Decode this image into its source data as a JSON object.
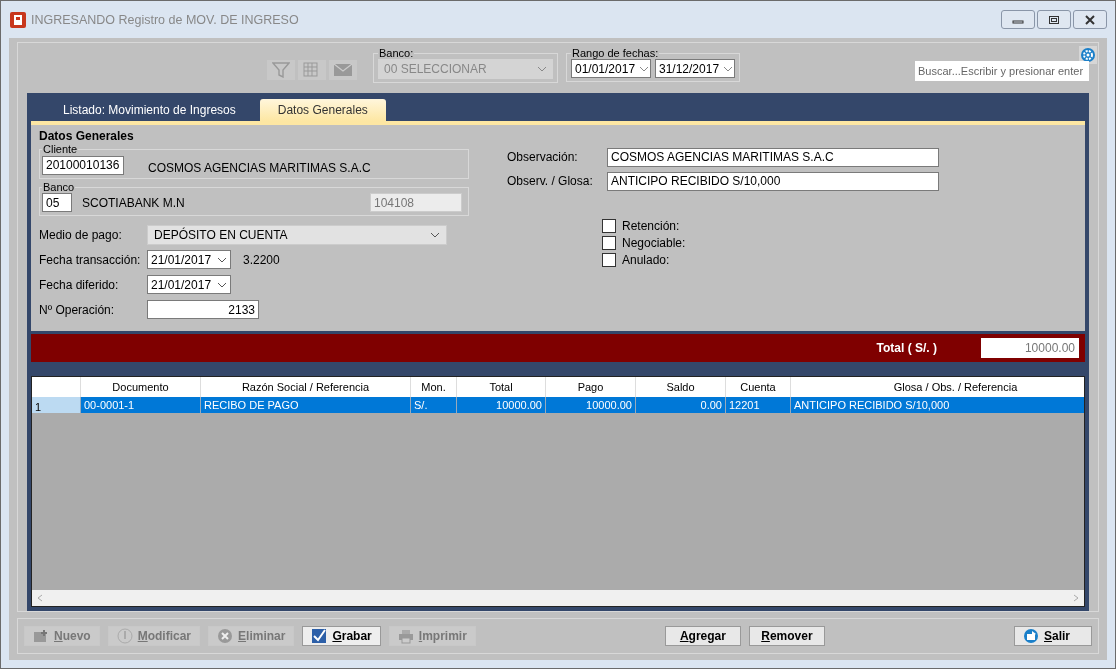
{
  "window": {
    "title": "INGRESANDO Registro de MOV. DE INGRESO"
  },
  "toolbar": {
    "banco": {
      "label": "Banco:",
      "value": "00 SELECCIONAR",
      "disabled": true
    },
    "rango": {
      "label": "Rango de fechas:",
      "from": "01/01/2017",
      "to": "31/12/2017"
    },
    "search": {
      "placeholder": "Buscar...Escribir y presionar enter"
    }
  },
  "tabs": [
    {
      "label": "Listado: Movimiento de Ingresos",
      "selected": false
    },
    {
      "label": "Datos Generales",
      "selected": true
    }
  ],
  "form": {
    "title": "Datos Generales",
    "cliente": {
      "label": "Cliente",
      "code": "20100010136",
      "name": "COSMOS AGENCIAS MARITIMAS S.A.C"
    },
    "banco": {
      "label": "Banco",
      "code": "05",
      "name": "SCOTIABANK M.N",
      "account": "104108"
    },
    "medio_pago": {
      "label": "Medio de pago:",
      "value": "DEPÓSITO EN CUENTA"
    },
    "fecha_transaccion": {
      "label": "Fecha transacción:",
      "value": "21/01/2017",
      "rate": "3.2200"
    },
    "fecha_diferido": {
      "label": "Fecha diferido:",
      "value": "21/01/2017"
    },
    "operacion": {
      "label": "Nº Operación:",
      "value": "2133"
    },
    "observacion": {
      "label": "Observación:",
      "value": "COSMOS AGENCIAS MARITIMAS S.A.C"
    },
    "glosa": {
      "label": "Observ. / Glosa:",
      "value": "ANTICIPO RECIBIDO S/10,000"
    },
    "checkboxes": [
      {
        "label": "Retención:",
        "checked": false
      },
      {
        "label": "Negociable:",
        "checked": false
      },
      {
        "label": "Anulado:",
        "checked": false
      }
    ]
  },
  "total": {
    "label": "Total ( S/. )",
    "value": "10000.00"
  },
  "table": {
    "columns": [
      "Documento",
      "Razón Social / Referencia",
      "Mon.",
      "Total",
      "Pago",
      "Saldo",
      "Cuenta",
      "Glosa / Obs. / Referencia"
    ],
    "rows": [
      {
        "number": "1",
        "selected": true,
        "cells": [
          "00-0001-1",
          "RECIBO DE PAGO",
          "S/.",
          "10000.00",
          "10000.00",
          "0.00",
          "12201",
          "ANTICIPO RECIBIDO S/10,000"
        ]
      }
    ]
  },
  "buttons": [
    {
      "label": "Nuevo",
      "kind": "nuevo",
      "disabled": true
    },
    {
      "label": "Modificar",
      "kind": "modificar",
      "disabled": true
    },
    {
      "label": "Eliminar",
      "kind": "eliminar",
      "disabled": true
    },
    {
      "label": "Grabar",
      "kind": "grabar",
      "disabled": false
    },
    {
      "label": "Imprimir",
      "kind": "imprimir",
      "disabled": true
    },
    {
      "label": "Agregar",
      "kind": "plain",
      "disabled": false
    },
    {
      "label": "Remover",
      "kind": "plain",
      "disabled": false
    },
    {
      "label": "Salir",
      "kind": "salir",
      "disabled": false
    }
  ]
}
